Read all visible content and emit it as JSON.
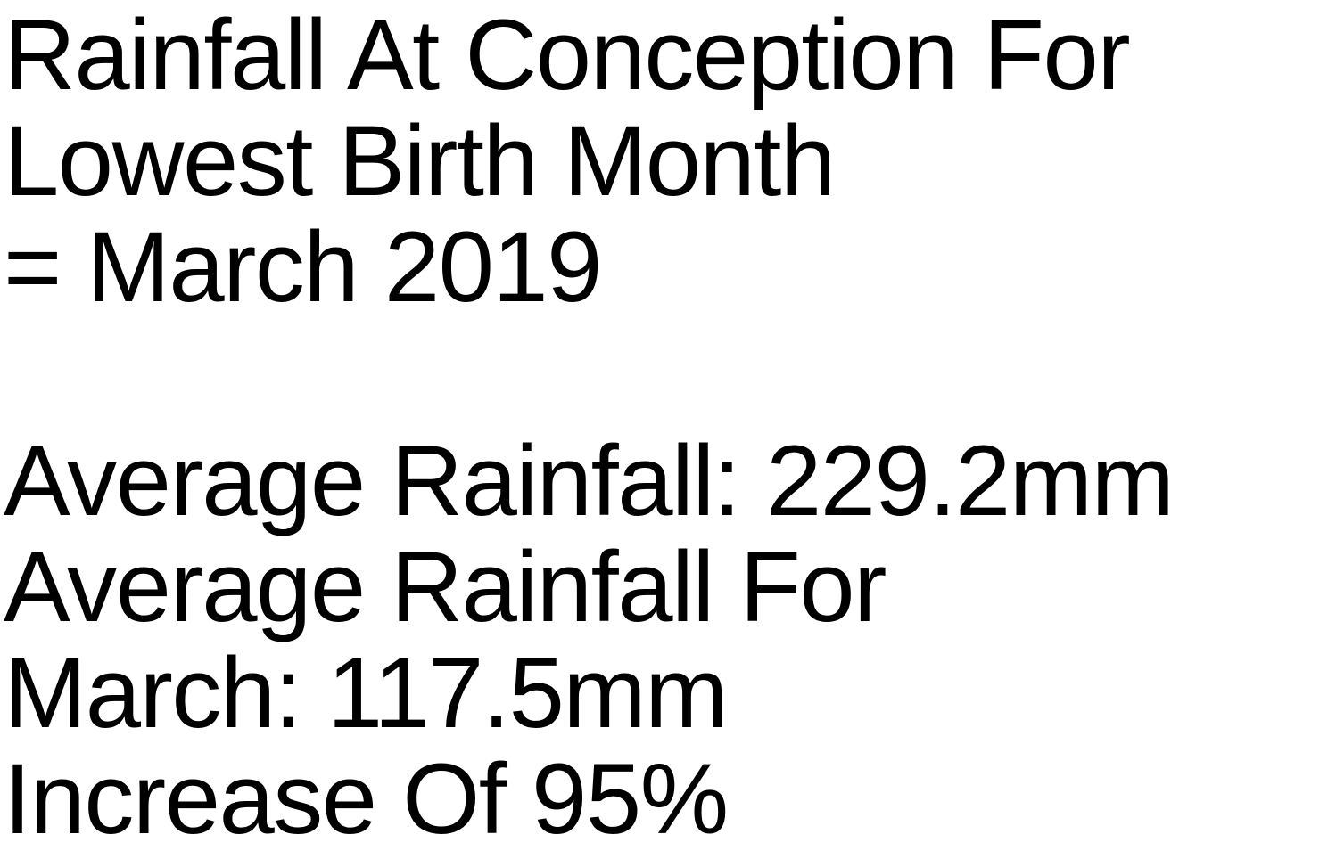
{
  "heading": {
    "lines": [
      "Rainfall At Conception For",
      "Lowest Birth Month",
      "= March 2019"
    ]
  },
  "stats": {
    "lines": [
      "Average Rainfall: 229.2mm",
      "Average Rainfall For",
      "March: 117.5mm",
      "Increase Of 95%"
    ]
  },
  "colors": {
    "background": "#ffffff",
    "text": "#000000"
  }
}
